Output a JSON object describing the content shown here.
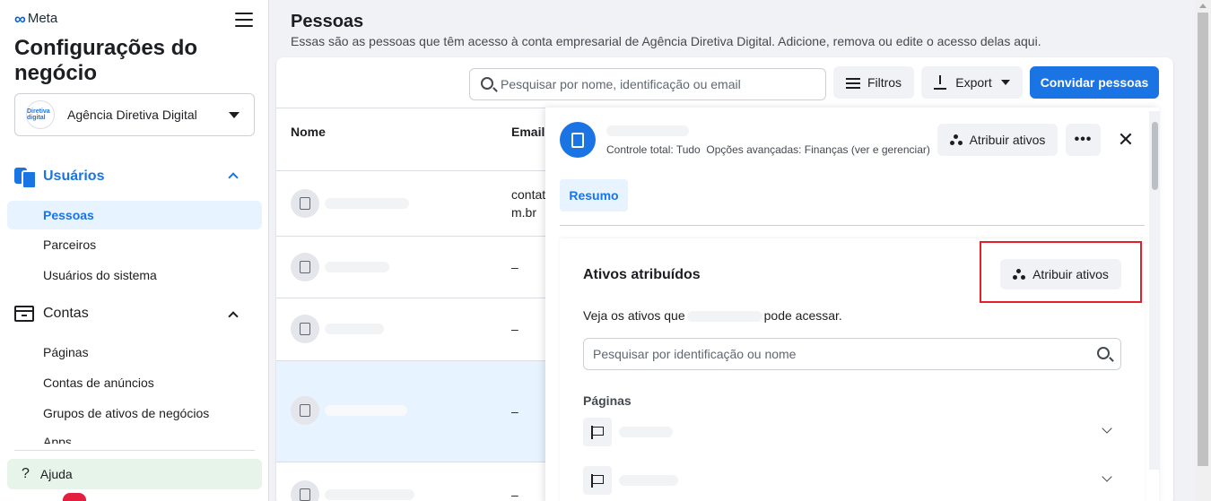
{
  "sidebar": {
    "logo_text": "Meta",
    "business_title": "Configurações do negócio",
    "account": {
      "name": "Agência Diretiva Digital",
      "logo_text": "Diretiva digital"
    },
    "users_section": {
      "label": "Usuários",
      "items": [
        {
          "label": "Pessoas",
          "active": true
        },
        {
          "label": "Parceiros"
        },
        {
          "label": "Usuários do sistema"
        }
      ]
    },
    "accounts_section": {
      "label": "Contas",
      "items": [
        {
          "label": "Páginas"
        },
        {
          "label": "Contas de anúncios"
        },
        {
          "label": "Grupos de ativos de negócios"
        },
        {
          "label": "Apps"
        }
      ]
    },
    "help_label": "Ajuda"
  },
  "main": {
    "title": "Pessoas",
    "subtitle": "Essas são as pessoas que têm acesso à conta empresarial de Agência Diretiva Digital. Adicione, remova ou edite o acesso delas aqui.",
    "search_placeholder": "Pesquisar por nome, identificação ou email",
    "filters_label": "Filtros",
    "export_label": "Export",
    "invite_label": "Convidar pessoas",
    "table": {
      "columns": [
        "Nome",
        "Email"
      ],
      "rows": [
        {
          "email_line1": "contat",
          "email_line2": "m.br"
        },
        {
          "email": "–"
        },
        {
          "email": "–"
        },
        {
          "email": "–",
          "selected": true
        },
        {
          "email": "–"
        }
      ]
    }
  },
  "panel": {
    "permission_text": "Controle total: Tudo",
    "advanced_text": "Opções avançadas: Finanças (ver e gerenciar)",
    "assign_label": "Atribuir ativos",
    "more_label": "•••",
    "close_label": "✕",
    "tab_label": "Resumo",
    "assigned_title": "Ativos atribuídos",
    "assigned_button_label": "Atribuir ativos",
    "desc_before": "Veja os ativos que",
    "desc_after": "pode acessar.",
    "asset_search_placeholder": "Pesquisar por identificação ou nome",
    "pages_label": "Páginas"
  },
  "colors": {
    "accent": "#1b74e4",
    "highlight": "#e41e2b"
  }
}
